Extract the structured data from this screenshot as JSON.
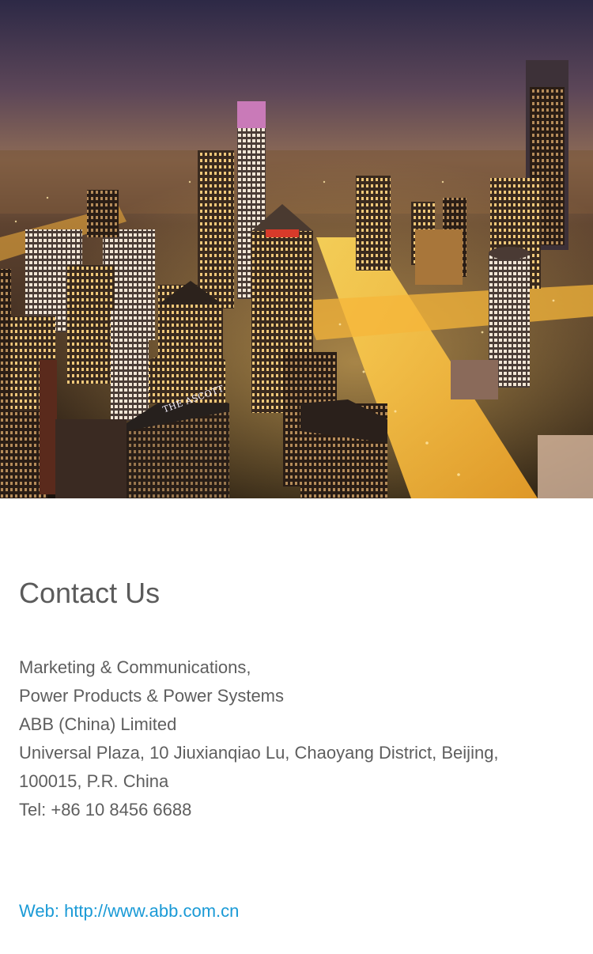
{
  "hero": {
    "image_description_icon": "city-skyline-night-image",
    "sign_text": "THE ASCOTT"
  },
  "contact": {
    "heading": "Contact Us",
    "address_lines": [
      "Marketing & Communications,",
      "Power Products & Power Systems",
      "ABB (China) Limited",
      "Universal Plaza, 10 Jiuxianqiao Lu, Chaoyang District, Beijing,",
      "100015, P.R. China",
      "Tel: +86 10 8456 6688"
    ],
    "web_label": "Web: ",
    "web_url": "http://www.abb.com.cn"
  },
  "colors": {
    "heading": "#5b5b5b",
    "body_text": "#5e5e5e",
    "link": "#1a9ad6",
    "background": "#ffffff"
  }
}
